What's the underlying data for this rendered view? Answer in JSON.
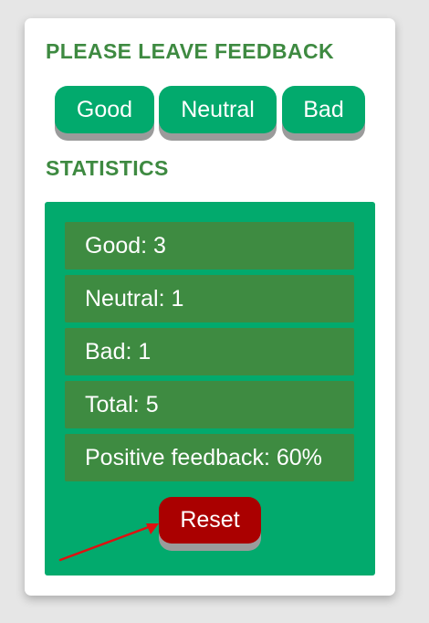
{
  "feedback": {
    "title": "PLEASE LEAVE FEEDBACK",
    "buttons": {
      "good": "Good",
      "neutral": "Neutral",
      "bad": "Bad"
    }
  },
  "statistics": {
    "title": "STATISTICS",
    "rows": [
      "Good: 3",
      "Neutral: 1",
      "Bad: 1",
      "Total: 5",
      "Positive feedback: 60%"
    ],
    "reset_label": "Reset"
  },
  "colors": {
    "heading": "#3e8a41",
    "button": "#02aa6d",
    "panel": "#02aa6d",
    "stat_row": "#3e8b41",
    "reset": "#aa0000",
    "annotation_arrow": "#e01010"
  },
  "icons": {
    "annotation": "arrow-icon"
  }
}
